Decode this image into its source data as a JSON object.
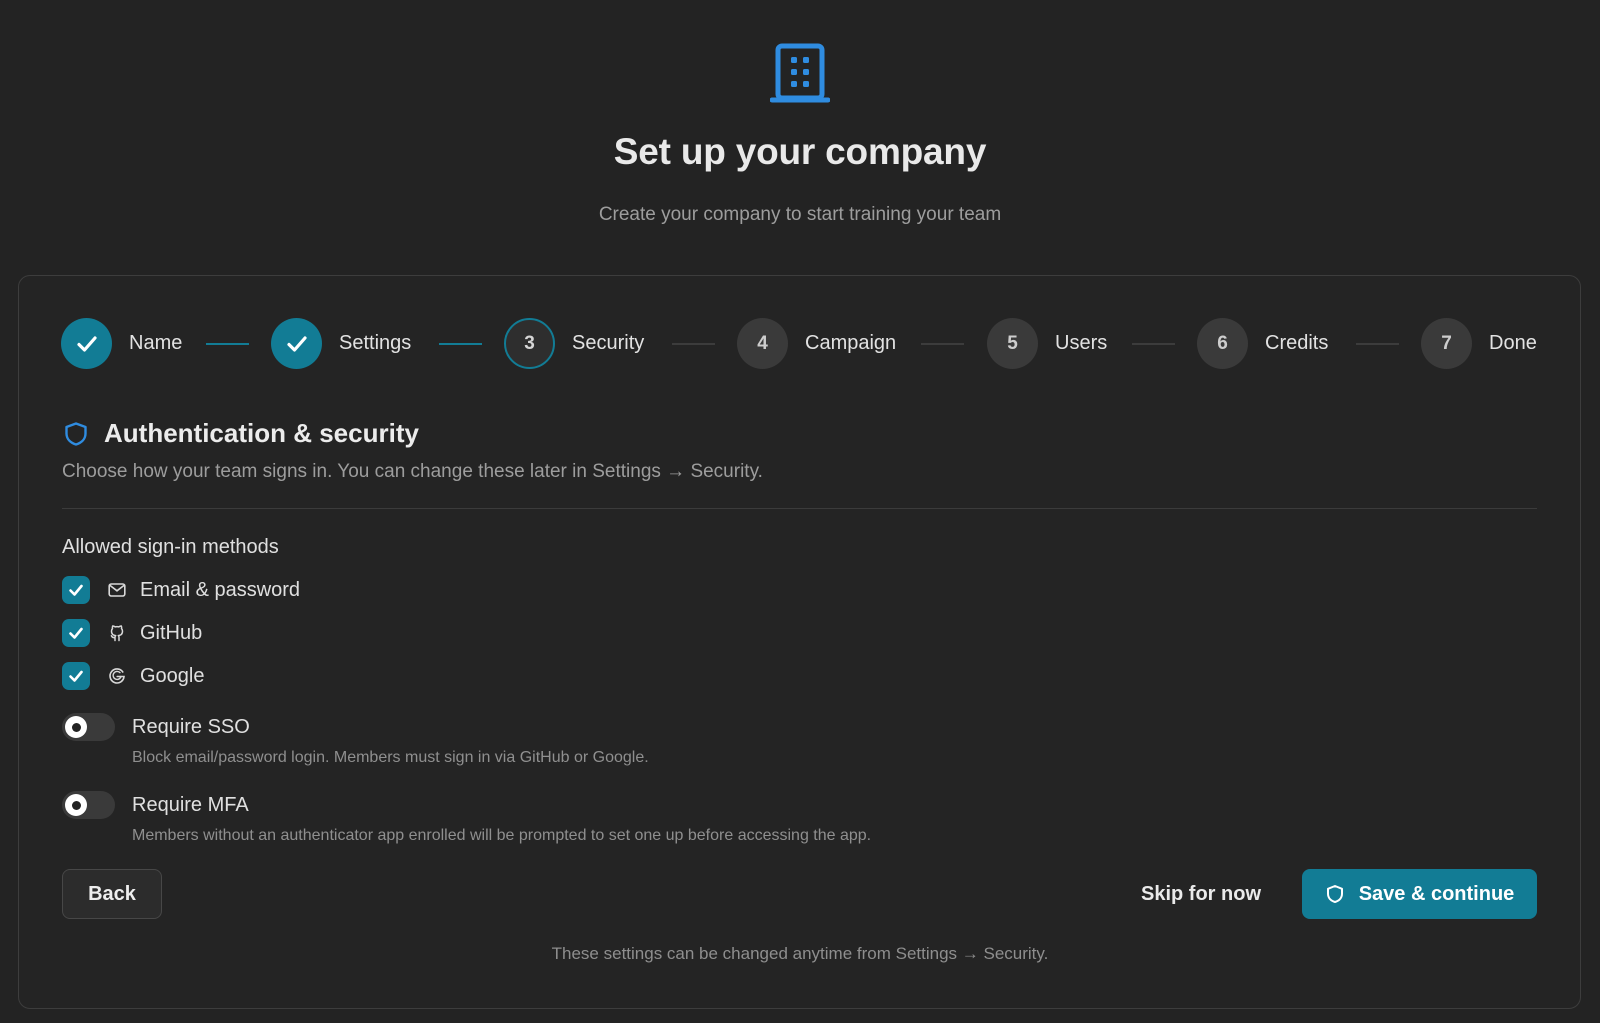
{
  "header": {
    "icon": "building-icon",
    "title": "Set up your company",
    "subtitle": "Create your company to start training your team"
  },
  "stepper": {
    "steps": [
      {
        "number": "1",
        "label": "Name",
        "status": "done"
      },
      {
        "number": "2",
        "label": "Settings",
        "status": "done"
      },
      {
        "number": "3",
        "label": "Security",
        "status": "current"
      },
      {
        "number": "4",
        "label": "Campaign",
        "status": "todo"
      },
      {
        "number": "5",
        "label": "Users",
        "status": "todo"
      },
      {
        "number": "6",
        "label": "Credits",
        "status": "todo"
      },
      {
        "number": "7",
        "label": "Done",
        "status": "todo"
      }
    ]
  },
  "section": {
    "icon": "shield-icon",
    "title": "Authentication & security",
    "description": "Choose how your team signs in. You can change these later in Settings → Security."
  },
  "signin": {
    "label": "Allowed sign-in methods",
    "methods": [
      {
        "label": "Email & password",
        "icon": "mail-icon",
        "checked": true
      },
      {
        "label": "GitHub",
        "icon": "github-icon",
        "checked": true
      },
      {
        "label": "Google",
        "icon": "google-icon",
        "checked": true
      }
    ]
  },
  "toggles": {
    "sso": {
      "label": "Require SSO",
      "description": "Block email/password login. Members must sign in via GitHub or Google.",
      "on": false
    },
    "mfa": {
      "label": "Require MFA",
      "description": "Members without an authenticator app enrolled will be prompted to set one up before accessing the app.",
      "on": false
    }
  },
  "actions": {
    "back": "Back",
    "skip": "Skip for now",
    "save": "Save & continue"
  },
  "footer": {
    "note": "These settings can be changed anytime from Settings → Security."
  },
  "colors": {
    "accent": "#127c95",
    "icon_blue": "#2f8ce0",
    "background": "#232323"
  }
}
